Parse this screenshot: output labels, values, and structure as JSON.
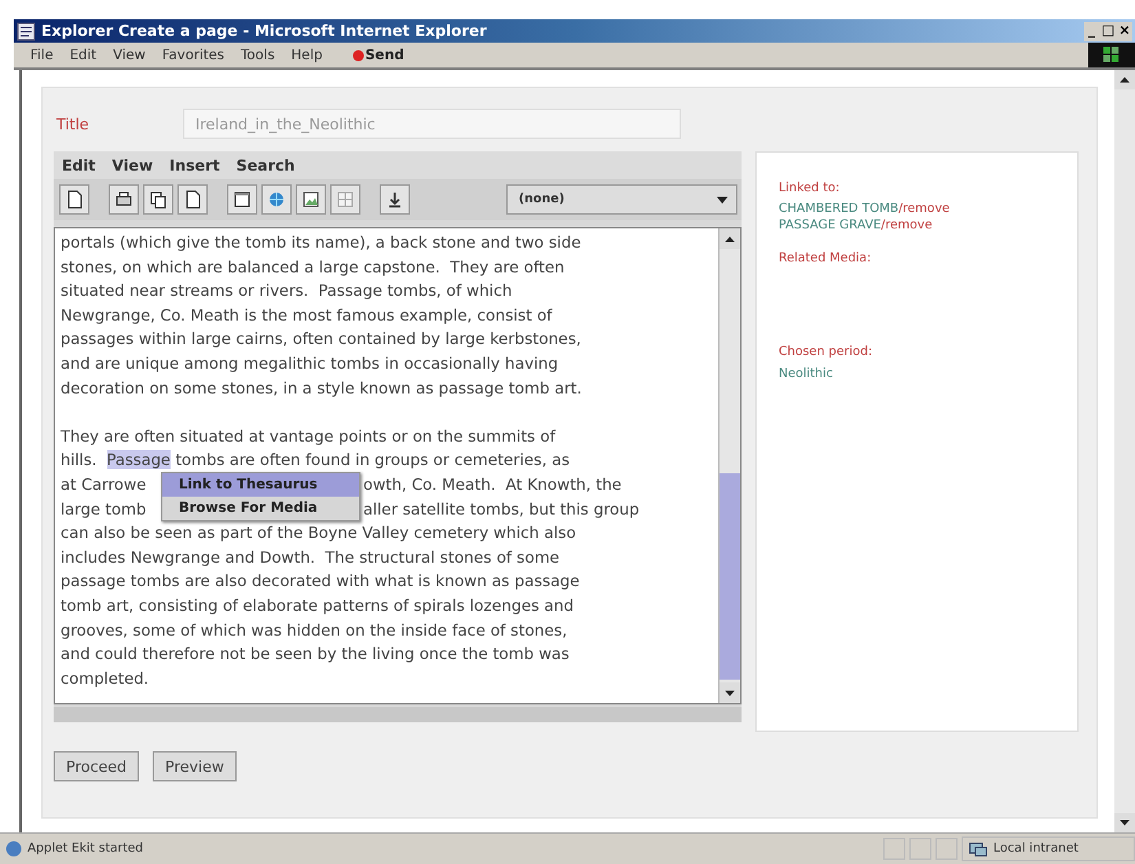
{
  "window": {
    "title": "Explorer Create a page - Microsoft Internet Explorer",
    "controls": [
      "_",
      "□",
      "×"
    ]
  },
  "menu_bar": {
    "items": [
      "File",
      "Edit",
      "View",
      "Favorites",
      "Tools",
      "Help"
    ],
    "send": "Send"
  },
  "form": {
    "title_label": "Title",
    "title_value": "Ireland_in_the_Neolithic"
  },
  "editor": {
    "menu": [
      "Edit",
      "View",
      "Insert",
      "Search"
    ],
    "style_select": "(none)",
    "paragraphs": [
      {
        "lines": [
          {
            "kind": "plain",
            "text": "portals (which give the tomb its name), a back stone and two side"
          },
          {
            "kind": "plain",
            "text": "stones, on which are balanced a large capstone.  They are often"
          },
          {
            "kind": "plain",
            "text": "situated near streams or rivers.  Passage tombs, of which"
          },
          {
            "kind": "plain",
            "text": "Newgrange, Co. Meath is the most famous example, consist of"
          },
          {
            "kind": "plain",
            "text": "passages within large cairns, often contained by large kerbstones,"
          },
          {
            "kind": "plain",
            "text": "and are unique among megalithic tombs in occasionally having"
          },
          {
            "kind": "plain",
            "text": "decoration on some stones, in a style known as passage tomb art."
          }
        ]
      },
      {
        "lines": [
          {
            "kind": "plain",
            "text": "They are often situated at vantage points or on the summits of"
          },
          {
            "kind": "segments",
            "segments": [
              {
                "text": "hills.  ",
                "selected": false
              },
              {
                "text": "Passage",
                "selected": true
              },
              {
                "text": " tombs are often found in groups or cemeteries, as",
                "selected": false
              }
            ]
          },
          {
            "kind": "split",
            "before": "at Carrowe",
            "after": "owth, Co. Meath.  At Knowth, the"
          },
          {
            "kind": "split",
            "before": "large tomb",
            "after": "aller satellite tombs, but this group"
          },
          {
            "kind": "plain",
            "text": "can also be seen as part of the Boyne Valley cemetery which also"
          },
          {
            "kind": "plain",
            "text": "includes Newgrange and Dowth.  The structural stones of some"
          },
          {
            "kind": "plain",
            "text": "passage tombs are also decorated with what is known as passage"
          },
          {
            "kind": "plain",
            "text": "tomb art, consisting of elaborate patterns of spirals lozenges and"
          },
          {
            "kind": "plain",
            "text": "grooves, some of which was hidden on the inside face of stones,"
          },
          {
            "kind": "plain",
            "text": "and could therefore not be seen by the living once the tomb was"
          },
          {
            "kind": "plain",
            "text": "completed."
          }
        ]
      }
    ]
  },
  "context_menu": {
    "items": [
      {
        "label": "Link to Thesaurus",
        "selected": true
      },
      {
        "label": "Browse For Media",
        "selected": false
      }
    ]
  },
  "side_panel": {
    "linked_label": "Linked to:",
    "links": [
      {
        "term": "CHAMBERED TOMB",
        "action": "/remove"
      },
      {
        "term": "PASSAGE GRAVE",
        "action": "/remove"
      }
    ],
    "media_label": "Related Media:",
    "period_label": "Chosen period:",
    "period": "Neolithic"
  },
  "buttons": [
    "Proceed",
    "Preview"
  ],
  "status_bar": {
    "text": "Applet Ekit started",
    "zone": "Local intranet"
  }
}
